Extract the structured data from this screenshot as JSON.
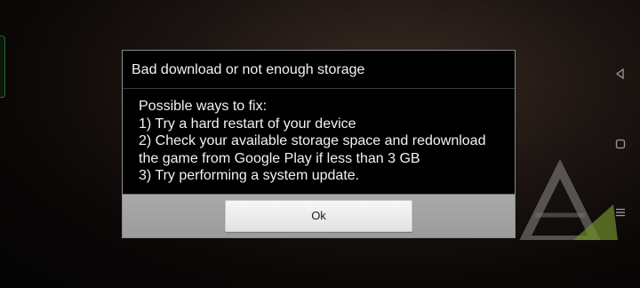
{
  "dialog": {
    "title": "Bad download or not enough storage",
    "body_lines": [
      "Possible ways to fix:",
      "1) Try a hard restart of your device",
      "2) Check your available storage space and redownload",
      "the game from Google Play if less than 3 GB",
      "3) Try performing a system update."
    ],
    "ok_label": "Ok"
  },
  "navbar": {
    "icons": [
      "back-icon",
      "home-icon",
      "menu-icon"
    ]
  },
  "colors": {
    "dialog_background": "#000000",
    "footer_background": "#a3a3a3",
    "button_background": "#efefef",
    "edge_handle": "#1f6e2a"
  }
}
